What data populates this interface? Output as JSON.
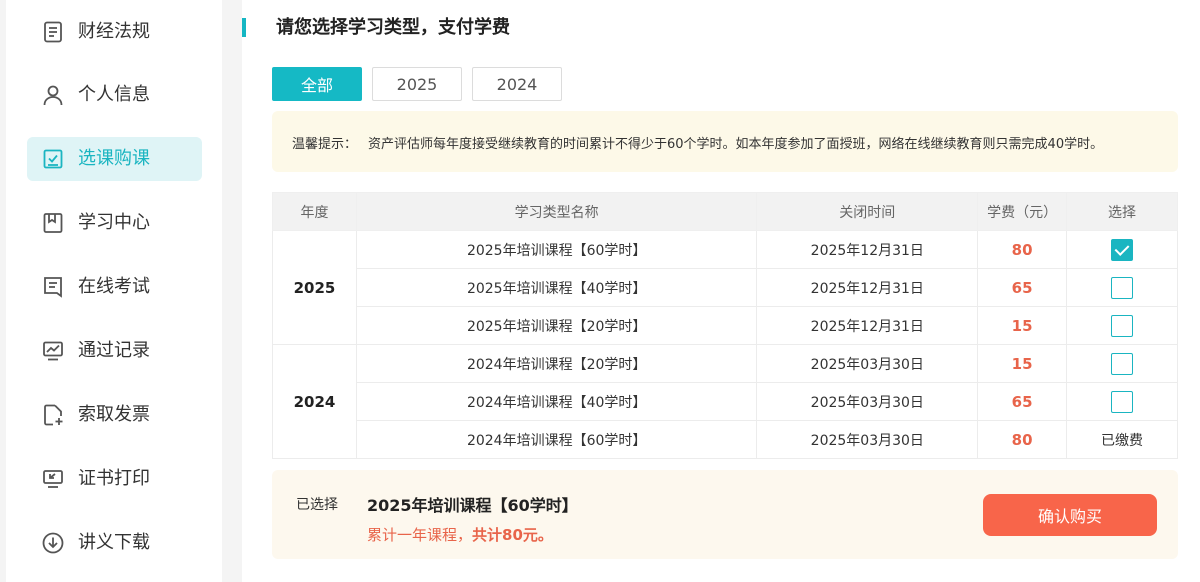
{
  "sidebar": {
    "items": [
      {
        "label": "财经法规",
        "icon": "document-icon"
      },
      {
        "label": "个人信息",
        "icon": "user-icon"
      },
      {
        "label": "选课购课",
        "icon": "checkbox-icon",
        "active": true
      },
      {
        "label": "学习中心",
        "icon": "bookmark-icon"
      },
      {
        "label": "在线考试",
        "icon": "exam-icon"
      },
      {
        "label": "通过记录",
        "icon": "chart-monitor-icon"
      },
      {
        "label": "索取发票",
        "icon": "file-add-icon"
      },
      {
        "label": "证书打印",
        "icon": "print-icon"
      },
      {
        "label": "讲义下载",
        "icon": "download-icon"
      }
    ]
  },
  "main": {
    "title": "请您选择学习类型，支付学费",
    "tabs": [
      {
        "label": "全部",
        "active": true
      },
      {
        "label": "2025"
      },
      {
        "label": "2024"
      }
    ],
    "notice": {
      "label": "温馨提示：",
      "text": "资产评估师每年度接受继续教育的时间累计不得少于60个学时。如本年度参加了面授班，网络在线继续教育则只需完成40学时。"
    },
    "table": {
      "headers": [
        "年度",
        "学习类型名称",
        "关闭时间",
        "学费（元）",
        "选择"
      ],
      "groups": [
        {
          "year": "2025",
          "rows": [
            {
              "name": "2025年培训课程【60学时】",
              "close": "2025年12月31日",
              "fee": "80",
              "state": "checked"
            },
            {
              "name": "2025年培训课程【40学时】",
              "close": "2025年12月31日",
              "fee": "65",
              "state": "unchecked"
            },
            {
              "name": "2025年培训课程【20学时】",
              "close": "2025年12月31日",
              "fee": "15",
              "state": "unchecked"
            }
          ]
        },
        {
          "year": "2024",
          "rows": [
            {
              "name": "2024年培训课程【20学时】",
              "close": "2025年03月30日",
              "fee": "15",
              "state": "unchecked"
            },
            {
              "name": "2024年培训课程【40学时】",
              "close": "2025年03月30日",
              "fee": "65",
              "state": "unchecked"
            },
            {
              "name": "2024年培训课程【60学时】",
              "close": "2025年03月30日",
              "fee": "80",
              "state": "paid",
              "paid_label": "已缴费"
            }
          ]
        }
      ]
    },
    "summary": {
      "label": "已选择",
      "course": "2025年培训课程【60学时】",
      "total_prefix": "累计一年课程，",
      "total_bold": "共计80元。",
      "confirm_label": "确认购买"
    }
  },
  "colors": {
    "accent": "#15b9c5",
    "fee": "#e8644a",
    "confirm": "#f8654a",
    "notice_bg": "#fdf9e8",
    "summary_bg": "#fdf8ee"
  }
}
